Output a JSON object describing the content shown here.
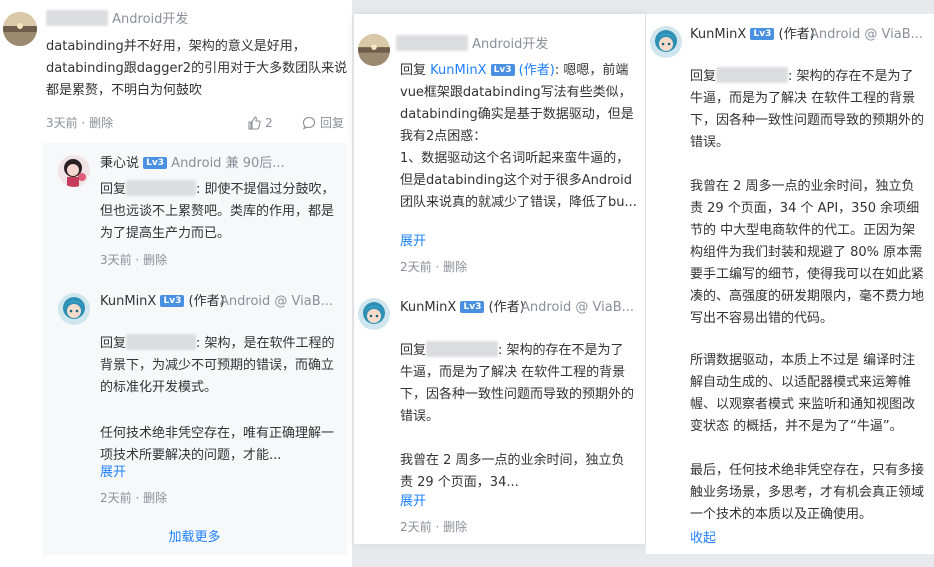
{
  "panel1": {
    "comment": {
      "dept": "Android开发",
      "text": "databinding并不好用，架构的意义是好用，databinding跟dagger2的引用对于大多数团队来说都是累赘，不明白为何鼓吹",
      "time": "3天前",
      "delete": "删除",
      "likes": "2",
      "reply_label": "回复"
    },
    "replies": [
      {
        "name": "秉心说",
        "level": "Lv3",
        "dept": "Android 兼 90后...",
        "reply_prefix": "回复",
        "reply_suffix": ": 即使不提倡过分鼓吹，但也远谈不上累赘吧。类库的作用，都是为了提高生产力而已。",
        "time": "3天前",
        "delete": "删除"
      },
      {
        "name": "KunMinX",
        "level": "Lv3",
        "role": "(作者)",
        "dept": "Android @ ViaB...",
        "reply_prefix": "回复",
        "reply_suffix": ": 架构，是在软件工程的背景下，为减少不可预期的错误，而确立的标准化开发模式。",
        "text2": "任何技术绝非凭空存在，唯有正确理解一项技术所要解决的问题，才能...",
        "expand": "展开",
        "time": "2天前",
        "delete": "删除"
      }
    ],
    "load_more": "加载更多"
  },
  "panel2": {
    "comment": {
      "dept": "Android开发",
      "reply_prefix": "回复",
      "target": "KunMinX",
      "level": "Lv3",
      "target_role": "(作者)",
      "text": ": 嗯嗯，前端vue框架跟databinding写法有些类似，databinding确实是基于数据驱动，但是我有2点困惑：",
      "text2": "1、数据驱动这个名词听起来蛮牛逼的，但是databinding这个对于很多Android团队来说真的就减少了错误，降低了bu...",
      "expand": "展开",
      "time": "2天前",
      "delete": "删除"
    },
    "reply": {
      "name": "KunMinX",
      "level": "Lv3",
      "role": "(作者)",
      "dept": "Android @ ViaB...",
      "reply_prefix": "回复",
      "reply_suffix": ": 架构的存在不是为了牛逼，而是为了解决 在软件工程的背景下，因各种一致性问题而导致的预期外的错误。",
      "text2": "我曾在 2 周多一点的业余时间，独立负责 29 个页面，34...",
      "expand": "展开",
      "time": "2天前",
      "delete": "删除"
    }
  },
  "panel3": {
    "name": "KunMinX",
    "level": "Lv3",
    "role": "(作者)",
    "dept": "Android @ ViaB...",
    "reply_prefix": "回复",
    "reply_suffix": ": 架构的存在不是为了牛逼，而是为了解决 在软件工程的背景下，因各种一致性问题而导致的预期外的错误。",
    "para2": "我曾在 2 周多一点的业余时间，独立负责 29 个页面，34 个 API，350 余项细节的 中大型电商软件的代工。正因为架构组件为我们封装和规避了 80% 原本需要手工编写的细节，使得我可以在如此紧凑的、高强度的研发期限内，毫不费力地写出不容易出错的代码。",
    "para3": "所谓数据驱动，本质上不过是 编译时注解自动生成的、以适配器模式来运筹帷幄、以观察者模式 来监听和通知视图改变状态 的概括，并不是为了“牛逼”。",
    "para4": "最后，任何技术绝非凭空存在，只有多接触业务场景，多思考，才有机会真正领域一个技术的本质以及正确使用。",
    "collapse": "收起"
  },
  "colors": {
    "accent": "#1e80ff",
    "level_badge": "#4a90e2",
    "meta": "#8a9099"
  }
}
